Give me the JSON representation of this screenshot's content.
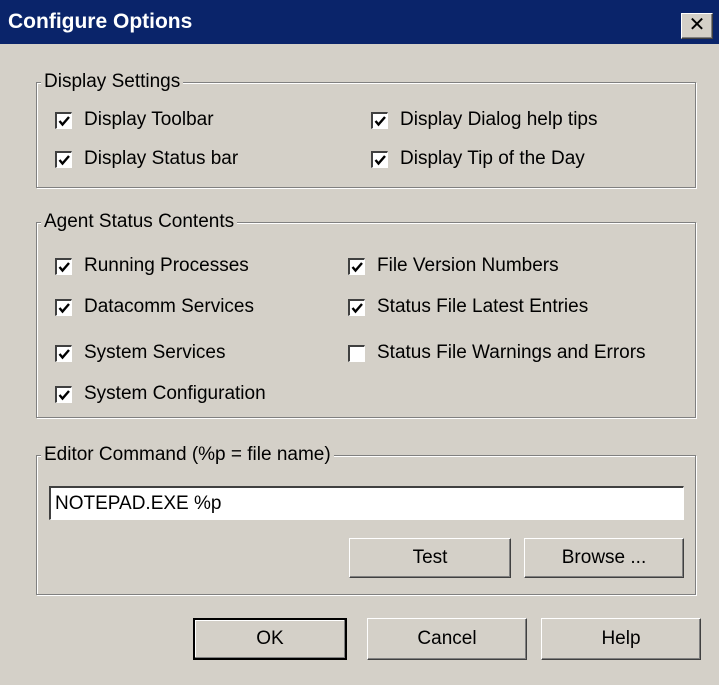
{
  "window": {
    "title": "Configure Options",
    "close_glyph": "✕"
  },
  "display_settings": {
    "label": "Display Settings",
    "items": [
      {
        "label": "Display Toolbar",
        "checked": true
      },
      {
        "label": "Display Status bar",
        "checked": true
      },
      {
        "label": "Display Dialog help tips",
        "checked": true
      },
      {
        "label": "Display Tip of the Day",
        "checked": true
      }
    ]
  },
  "agent_status": {
    "label": "Agent Status Contents",
    "items": [
      {
        "label": "Running Processes",
        "checked": true
      },
      {
        "label": "Datacomm Services",
        "checked": true
      },
      {
        "label": "System Services",
        "checked": true
      },
      {
        "label": "System Configuration",
        "checked": true
      },
      {
        "label": "File Version Numbers",
        "checked": true
      },
      {
        "label": "Status File Latest Entries",
        "checked": true
      },
      {
        "label": "Status File Warnings and Errors",
        "checked": false
      }
    ]
  },
  "editor": {
    "label": "Editor Command (%p = file name)",
    "value": "NOTEPAD.EXE %p",
    "test_label": "Test",
    "browse_label": "Browse ..."
  },
  "buttons": {
    "ok": "OK",
    "cancel": "Cancel",
    "help": "Help"
  },
  "icons": {
    "close": "close-icon",
    "check": "checkmark-icon"
  },
  "colors": {
    "titlebar": "#0a246a",
    "face": "#d4d0c8"
  }
}
